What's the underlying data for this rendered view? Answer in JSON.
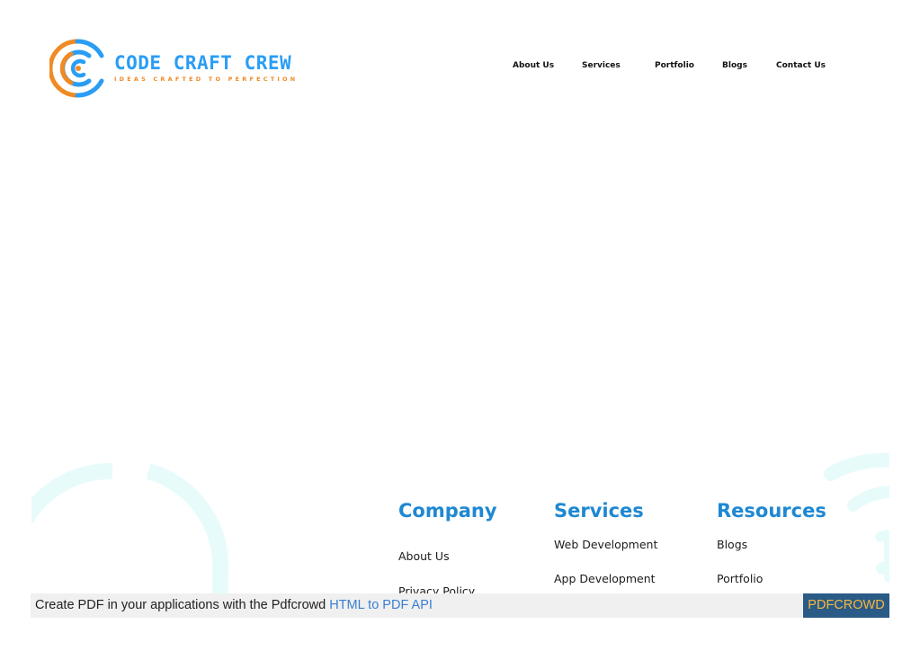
{
  "brand": {
    "name": "CODE CRAFT CREW",
    "tagline": "IDEAS CRAFTED TO PERFECTION",
    "logo_icon": "concentric-c-logo-icon",
    "colors": {
      "primary": "#2a9df4",
      "accent": "#f08a24",
      "heading_blue": "#1e88d2",
      "deco_cyan": "#e8fbfb"
    }
  },
  "nav": {
    "items": [
      {
        "label": "About Us"
      },
      {
        "label": "Services"
      },
      {
        "label": "Portfolio"
      },
      {
        "label": "Blogs"
      },
      {
        "label": "Contact Us"
      }
    ]
  },
  "footer": {
    "columns": [
      {
        "heading": "Company",
        "links": [
          "About Us",
          "Privacy Policy"
        ]
      },
      {
        "heading": "Services",
        "links": [
          "Web Development",
          "App Development"
        ]
      },
      {
        "heading": "Resources",
        "links": [
          "Blogs",
          "Portfolio"
        ]
      }
    ]
  },
  "pdf_banner": {
    "text": "Create PDF in your applications with the Pdfcrowd ",
    "link_text": "HTML to PDF API",
    "badge": "PDFCROWD",
    "colors": {
      "background": "#f0f0f0",
      "link": "#3a7fd0",
      "badge_bg": "#2a5a86",
      "badge_text": "#f7b93e"
    }
  }
}
